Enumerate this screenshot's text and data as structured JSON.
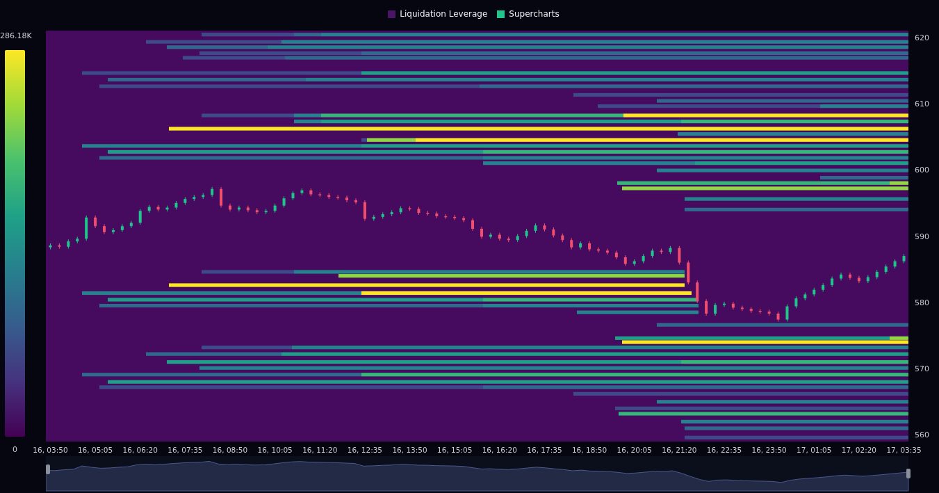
{
  "legend": [
    {
      "label": "Liquidation Leverage",
      "color": "#4a1467"
    },
    {
      "label": "Supercharts",
      "color": "#20c58c"
    }
  ],
  "color_scale": {
    "max_label": "286.18K",
    "min_label": "0"
  },
  "chart": {
    "chart_data": {
      "type": "candlestick",
      "ylim": [
        559,
        621
      ],
      "yticks": [
        {
          "value": 560,
          "label": "560"
        },
        {
          "value": 570,
          "label": "570"
        },
        {
          "value": 580,
          "label": "580"
        },
        {
          "value": 590,
          "label": "590"
        },
        {
          "value": 600,
          "label": "600"
        },
        {
          "value": 610,
          "label": "610"
        },
        {
          "value": 620,
          "label": "620"
        }
      ],
      "categories": [
        "16, 03:50",
        null,
        null,
        null,
        null,
        "16, 05:05",
        null,
        null,
        null,
        null,
        "16, 06:20",
        null,
        null,
        null,
        null,
        "16, 07:35",
        null,
        null,
        null,
        null,
        "16, 08:50",
        null,
        null,
        null,
        null,
        "16, 10:05",
        null,
        null,
        null,
        null,
        "16, 11:20",
        null,
        null,
        null,
        null,
        "16, 12:35",
        null,
        null,
        null,
        null,
        "16, 13:50",
        null,
        null,
        null,
        null,
        "16, 15:05",
        null,
        null,
        null,
        null,
        "16, 16:20",
        null,
        null,
        null,
        null,
        "16, 17:35",
        null,
        null,
        null,
        null,
        "16, 18:50",
        null,
        null,
        null,
        null,
        "16, 20:05",
        null,
        null,
        null,
        null,
        "16, 21:20",
        null,
        null,
        null,
        null,
        "16, 22:35",
        null,
        null,
        null,
        null,
        "16, 23:50",
        null,
        null,
        null,
        null,
        "17, 01:05",
        null,
        null,
        null,
        null,
        "17, 02:20",
        null,
        null,
        null,
        null,
        "17, 03:35"
      ],
      "ohlc": [
        [
          588.3,
          588.9,
          588.0,
          588.6
        ],
        [
          588.6,
          588.9,
          588.1,
          588.4
        ],
        [
          588.4,
          589.5,
          588.1,
          589.2
        ],
        [
          589.2,
          589.9,
          588.9,
          589.6
        ],
        [
          589.6,
          593.1,
          589.3,
          592.8
        ],
        [
          592.8,
          593.1,
          591.2,
          591.5
        ],
        [
          591.5,
          591.8,
          590.3,
          590.6
        ],
        [
          590.6,
          591.2,
          590.3,
          590.9
        ],
        [
          590.9,
          591.8,
          590.6,
          591.5
        ],
        [
          591.5,
          592.3,
          591.2,
          592.0
        ],
        [
          592.0,
          594.1,
          591.7,
          593.8
        ],
        [
          593.8,
          594.7,
          593.5,
          594.4
        ],
        [
          594.4,
          594.7,
          593.7,
          594.0
        ],
        [
          594.0,
          594.6,
          593.7,
          594.3
        ],
        [
          594.3,
          595.3,
          594.0,
          595.0
        ],
        [
          595.0,
          595.9,
          594.7,
          595.6
        ],
        [
          595.6,
          596.2,
          595.3,
          595.9
        ],
        [
          595.9,
          596.5,
          595.6,
          596.2
        ],
        [
          596.2,
          597.4,
          595.9,
          597.1
        ],
        [
          597.1,
          597.4,
          594.3,
          594.6
        ],
        [
          594.6,
          594.9,
          593.7,
          594.0
        ],
        [
          594.0,
          594.6,
          593.7,
          594.3
        ],
        [
          594.3,
          594.6,
          593.6,
          593.9
        ],
        [
          593.9,
          594.2,
          593.3,
          593.6
        ],
        [
          593.6,
          594.1,
          593.3,
          593.8
        ],
        [
          593.8,
          594.9,
          593.5,
          594.6
        ],
        [
          594.6,
          596.0,
          594.3,
          595.7
        ],
        [
          595.7,
          596.8,
          595.4,
          596.5
        ],
        [
          596.5,
          597.2,
          596.2,
          596.9
        ],
        [
          596.9,
          597.2,
          596.0,
          596.3
        ],
        [
          596.3,
          596.6,
          595.9,
          596.2
        ],
        [
          596.2,
          596.5,
          595.6,
          595.9
        ],
        [
          595.9,
          596.2,
          595.5,
          595.8
        ],
        [
          595.8,
          596.1,
          595.1,
          595.4
        ],
        [
          595.4,
          595.7,
          594.8,
          595.1
        ],
        [
          595.1,
          595.4,
          592.3,
          592.6
        ],
        [
          592.6,
          593.2,
          592.3,
          592.9
        ],
        [
          592.9,
          593.6,
          592.6,
          593.3
        ],
        [
          593.3,
          593.9,
          593.0,
          593.6
        ],
        [
          593.6,
          594.5,
          593.3,
          594.2
        ],
        [
          594.2,
          594.5,
          593.8,
          594.1
        ],
        [
          594.1,
          594.4,
          593.2,
          593.5
        ],
        [
          593.5,
          593.8,
          593.1,
          593.4
        ],
        [
          593.4,
          593.7,
          592.7,
          593.0
        ],
        [
          593.0,
          593.3,
          592.6,
          592.9
        ],
        [
          592.9,
          593.2,
          592.4,
          592.7
        ],
        [
          592.7,
          593.0,
          592.1,
          592.4
        ],
        [
          592.4,
          592.7,
          590.8,
          591.1
        ],
        [
          591.1,
          591.4,
          589.6,
          589.9
        ],
        [
          589.9,
          590.5,
          589.6,
          590.2
        ],
        [
          590.2,
          590.5,
          589.3,
          589.6
        ],
        [
          589.6,
          589.9,
          589.1,
          589.4
        ],
        [
          589.4,
          590.3,
          589.1,
          590.0
        ],
        [
          590.0,
          591.1,
          589.7,
          590.8
        ],
        [
          590.8,
          591.9,
          590.5,
          591.6
        ],
        [
          591.6,
          591.9,
          590.7,
          591.0
        ],
        [
          591.0,
          591.3,
          589.8,
          590.1
        ],
        [
          590.1,
          590.4,
          589.1,
          589.4
        ],
        [
          589.4,
          589.7,
          588.0,
          588.3
        ],
        [
          588.3,
          589.2,
          588.0,
          588.9
        ],
        [
          588.9,
          589.2,
          587.7,
          588.0
        ],
        [
          588.0,
          588.3,
          587.5,
          587.8
        ],
        [
          587.8,
          588.1,
          587.2,
          587.5
        ],
        [
          587.5,
          587.8,
          586.5,
          586.8
        ],
        [
          586.8,
          587.1,
          585.5,
          585.8
        ],
        [
          585.8,
          586.5,
          585.5,
          586.2
        ],
        [
          586.2,
          587.3,
          585.9,
          587.0
        ],
        [
          587.0,
          588.1,
          586.7,
          587.8
        ],
        [
          587.8,
          588.1,
          587.3,
          587.6
        ],
        [
          587.6,
          588.5,
          587.3,
          588.2
        ],
        [
          588.2,
          588.5,
          585.7,
          586.0
        ],
        [
          586.0,
          586.3,
          582.7,
          583.0
        ],
        [
          583.0,
          583.3,
          579.9,
          580.2
        ],
        [
          580.2,
          580.5,
          578.0,
          578.3
        ],
        [
          578.3,
          579.9,
          578.0,
          579.6
        ],
        [
          579.6,
          580.1,
          579.3,
          579.8
        ],
        [
          579.8,
          580.1,
          578.9,
          579.2
        ],
        [
          579.2,
          579.5,
          578.7,
          579.0
        ],
        [
          579.0,
          579.3,
          578.4,
          578.7
        ],
        [
          578.7,
          579.0,
          578.3,
          578.6
        ],
        [
          578.6,
          578.9,
          578.0,
          578.3
        ],
        [
          578.3,
          578.6,
          577.1,
          577.4
        ],
        [
          577.4,
          579.7,
          577.1,
          579.4
        ],
        [
          579.4,
          580.9,
          579.1,
          580.6
        ],
        [
          580.6,
          581.5,
          580.3,
          581.2
        ],
        [
          581.2,
          582.2,
          580.9,
          581.9
        ],
        [
          581.9,
          582.9,
          581.6,
          582.6
        ],
        [
          582.6,
          583.9,
          582.3,
          583.6
        ],
        [
          583.6,
          584.5,
          583.3,
          584.2
        ],
        [
          584.2,
          584.5,
          583.4,
          583.7
        ],
        [
          583.7,
          584.0,
          582.9,
          583.2
        ],
        [
          583.2,
          584.1,
          582.9,
          583.8
        ],
        [
          583.8,
          584.9,
          583.5,
          584.6
        ],
        [
          584.6,
          585.7,
          584.3,
          585.4
        ],
        [
          585.4,
          586.5,
          585.1,
          586.2
        ],
        [
          586.2,
          587.3,
          585.9,
          587.0
        ]
      ]
    }
  }
}
